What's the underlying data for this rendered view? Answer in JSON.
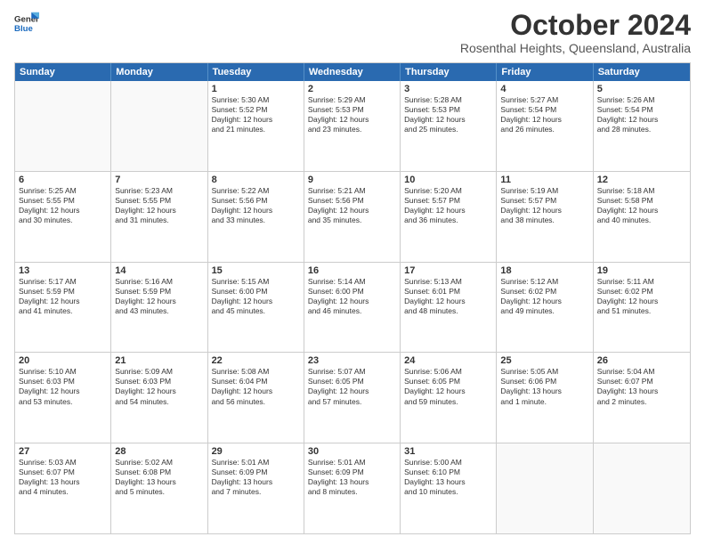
{
  "header": {
    "logo_line1": "General",
    "logo_line2": "Blue",
    "month": "October 2024",
    "location": "Rosenthal Heights, Queensland, Australia"
  },
  "weekdays": [
    "Sunday",
    "Monday",
    "Tuesday",
    "Wednesday",
    "Thursday",
    "Friday",
    "Saturday"
  ],
  "rows": [
    [
      {
        "day": "",
        "text": ""
      },
      {
        "day": "",
        "text": ""
      },
      {
        "day": "1",
        "text": "Sunrise: 5:30 AM\nSunset: 5:52 PM\nDaylight: 12 hours\nand 21 minutes."
      },
      {
        "day": "2",
        "text": "Sunrise: 5:29 AM\nSunset: 5:53 PM\nDaylight: 12 hours\nand 23 minutes."
      },
      {
        "day": "3",
        "text": "Sunrise: 5:28 AM\nSunset: 5:53 PM\nDaylight: 12 hours\nand 25 minutes."
      },
      {
        "day": "4",
        "text": "Sunrise: 5:27 AM\nSunset: 5:54 PM\nDaylight: 12 hours\nand 26 minutes."
      },
      {
        "day": "5",
        "text": "Sunrise: 5:26 AM\nSunset: 5:54 PM\nDaylight: 12 hours\nand 28 minutes."
      }
    ],
    [
      {
        "day": "6",
        "text": "Sunrise: 5:25 AM\nSunset: 5:55 PM\nDaylight: 12 hours\nand 30 minutes."
      },
      {
        "day": "7",
        "text": "Sunrise: 5:23 AM\nSunset: 5:55 PM\nDaylight: 12 hours\nand 31 minutes."
      },
      {
        "day": "8",
        "text": "Sunrise: 5:22 AM\nSunset: 5:56 PM\nDaylight: 12 hours\nand 33 minutes."
      },
      {
        "day": "9",
        "text": "Sunrise: 5:21 AM\nSunset: 5:56 PM\nDaylight: 12 hours\nand 35 minutes."
      },
      {
        "day": "10",
        "text": "Sunrise: 5:20 AM\nSunset: 5:57 PM\nDaylight: 12 hours\nand 36 minutes."
      },
      {
        "day": "11",
        "text": "Sunrise: 5:19 AM\nSunset: 5:57 PM\nDaylight: 12 hours\nand 38 minutes."
      },
      {
        "day": "12",
        "text": "Sunrise: 5:18 AM\nSunset: 5:58 PM\nDaylight: 12 hours\nand 40 minutes."
      }
    ],
    [
      {
        "day": "13",
        "text": "Sunrise: 5:17 AM\nSunset: 5:59 PM\nDaylight: 12 hours\nand 41 minutes."
      },
      {
        "day": "14",
        "text": "Sunrise: 5:16 AM\nSunset: 5:59 PM\nDaylight: 12 hours\nand 43 minutes."
      },
      {
        "day": "15",
        "text": "Sunrise: 5:15 AM\nSunset: 6:00 PM\nDaylight: 12 hours\nand 45 minutes."
      },
      {
        "day": "16",
        "text": "Sunrise: 5:14 AM\nSunset: 6:00 PM\nDaylight: 12 hours\nand 46 minutes."
      },
      {
        "day": "17",
        "text": "Sunrise: 5:13 AM\nSunset: 6:01 PM\nDaylight: 12 hours\nand 48 minutes."
      },
      {
        "day": "18",
        "text": "Sunrise: 5:12 AM\nSunset: 6:02 PM\nDaylight: 12 hours\nand 49 minutes."
      },
      {
        "day": "19",
        "text": "Sunrise: 5:11 AM\nSunset: 6:02 PM\nDaylight: 12 hours\nand 51 minutes."
      }
    ],
    [
      {
        "day": "20",
        "text": "Sunrise: 5:10 AM\nSunset: 6:03 PM\nDaylight: 12 hours\nand 53 minutes."
      },
      {
        "day": "21",
        "text": "Sunrise: 5:09 AM\nSunset: 6:03 PM\nDaylight: 12 hours\nand 54 minutes."
      },
      {
        "day": "22",
        "text": "Sunrise: 5:08 AM\nSunset: 6:04 PM\nDaylight: 12 hours\nand 56 minutes."
      },
      {
        "day": "23",
        "text": "Sunrise: 5:07 AM\nSunset: 6:05 PM\nDaylight: 12 hours\nand 57 minutes."
      },
      {
        "day": "24",
        "text": "Sunrise: 5:06 AM\nSunset: 6:05 PM\nDaylight: 12 hours\nand 59 minutes."
      },
      {
        "day": "25",
        "text": "Sunrise: 5:05 AM\nSunset: 6:06 PM\nDaylight: 13 hours\nand 1 minute."
      },
      {
        "day": "26",
        "text": "Sunrise: 5:04 AM\nSunset: 6:07 PM\nDaylight: 13 hours\nand 2 minutes."
      }
    ],
    [
      {
        "day": "27",
        "text": "Sunrise: 5:03 AM\nSunset: 6:07 PM\nDaylight: 13 hours\nand 4 minutes."
      },
      {
        "day": "28",
        "text": "Sunrise: 5:02 AM\nSunset: 6:08 PM\nDaylight: 13 hours\nand 5 minutes."
      },
      {
        "day": "29",
        "text": "Sunrise: 5:01 AM\nSunset: 6:09 PM\nDaylight: 13 hours\nand 7 minutes."
      },
      {
        "day": "30",
        "text": "Sunrise: 5:01 AM\nSunset: 6:09 PM\nDaylight: 13 hours\nand 8 minutes."
      },
      {
        "day": "31",
        "text": "Sunrise: 5:00 AM\nSunset: 6:10 PM\nDaylight: 13 hours\nand 10 minutes."
      },
      {
        "day": "",
        "text": ""
      },
      {
        "day": "",
        "text": ""
      }
    ]
  ]
}
